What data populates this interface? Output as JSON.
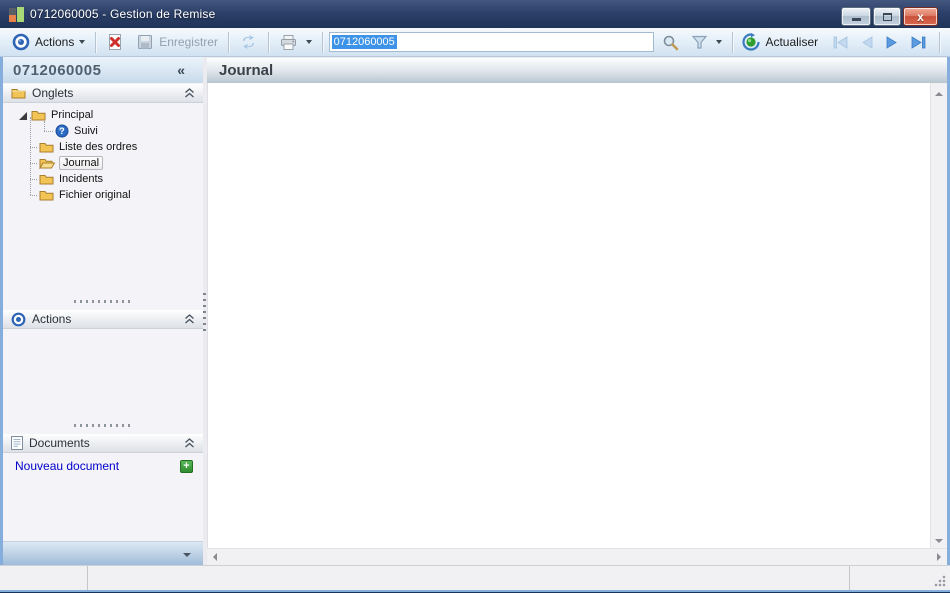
{
  "window": {
    "title": "0712060005 -  Gestion de Remise"
  },
  "toolbar": {
    "actions": {
      "label": "Actions"
    },
    "save": {
      "label": "Enregistrer"
    },
    "record_input": {
      "value": "0712060005"
    },
    "refresh": {
      "label": "Actualiser"
    }
  },
  "sidebar": {
    "header": {
      "record_id": "0712060005",
      "collapse_glyph": "«"
    },
    "onglets": {
      "title": "Onglets",
      "tree": [
        {
          "label": "Principal",
          "icon": "folder-closed",
          "expanded": true
        },
        {
          "label": "Suivi",
          "icon": "help-icon",
          "child_of": "Principal"
        },
        {
          "label": "Liste des ordres",
          "icon": "folder-closed"
        },
        {
          "label": "Journal",
          "icon": "folder-open",
          "selected": true
        },
        {
          "label": "Incidents",
          "icon": "folder-closed"
        },
        {
          "label": "Fichier original",
          "icon": "folder-closed"
        }
      ]
    },
    "actions_panel": {
      "title": "Actions"
    },
    "documents_panel": {
      "title": "Documents",
      "new_document_label": "Nouveau document"
    }
  },
  "main": {
    "title": "Journal"
  },
  "colors": {
    "titlebar": "#2c4069",
    "toolbar": "#e3eef8",
    "selection": "#3d93e7",
    "link": "#0000cc",
    "folder": "#f2c455",
    "close_button": "#c9503a"
  }
}
